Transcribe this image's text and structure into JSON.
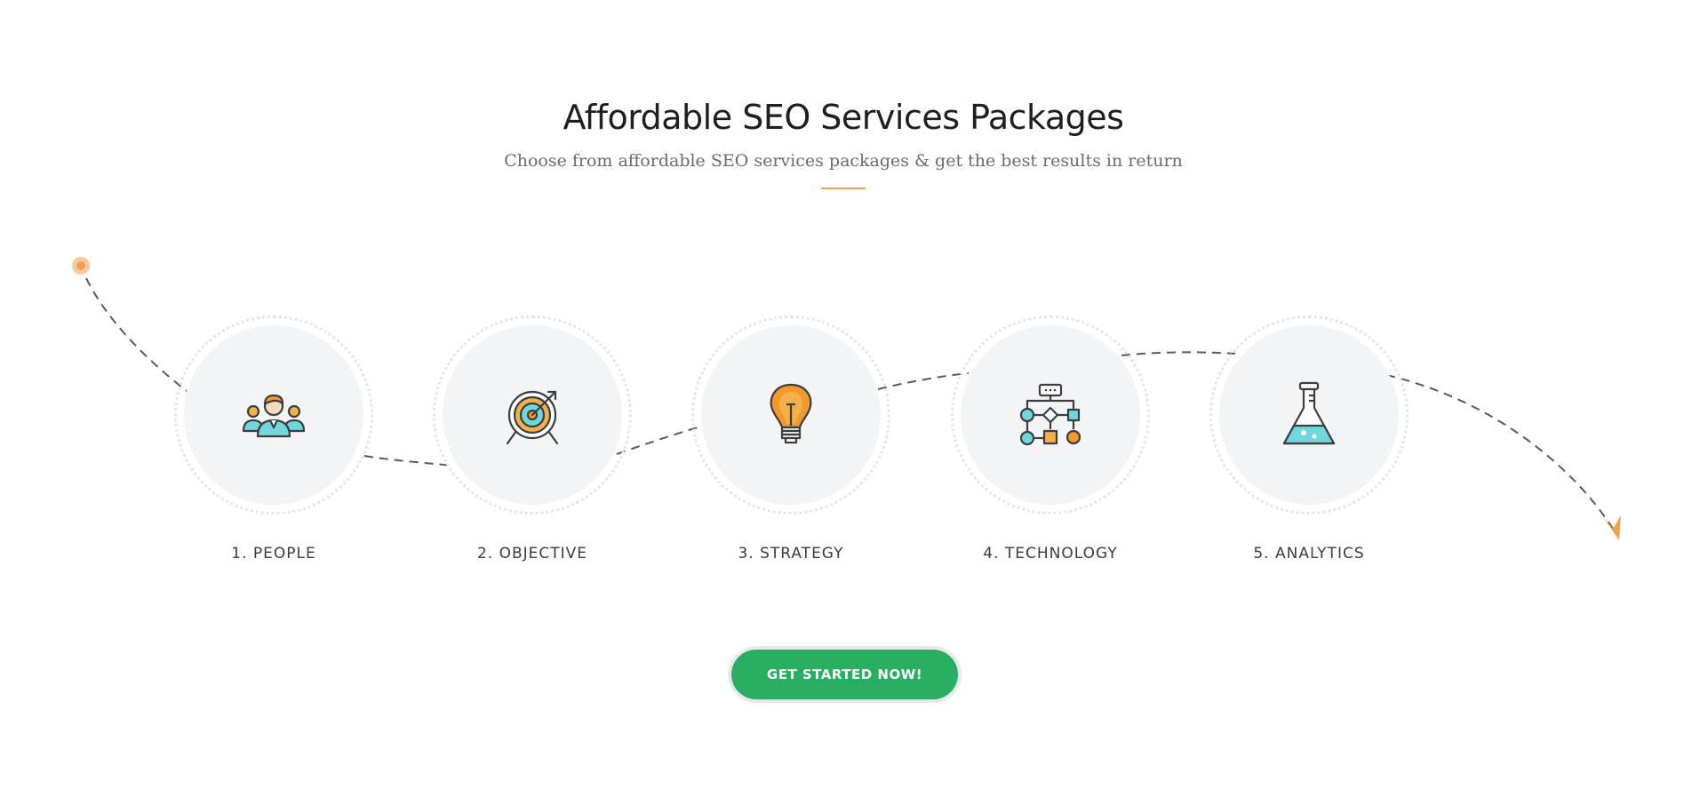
{
  "header": {
    "title": "Affordable SEO Services Packages",
    "subtitle": "Choose from affordable SEO services packages & get the best results in return"
  },
  "colors": {
    "accent": "#f0a050",
    "cta": "#27ae60",
    "circle_bg": "#f3f4f6",
    "teal": "#6fd8dc",
    "orange": "#f2992e"
  },
  "steps": [
    {
      "label": "1. PEOPLE",
      "icon": "people-icon"
    },
    {
      "label": "2. OBJECTIVE",
      "icon": "target-icon"
    },
    {
      "label": "3. STRATEGY",
      "icon": "lightbulb-icon"
    },
    {
      "label": "4. TECHNOLOGY",
      "icon": "flowchart-icon"
    },
    {
      "label": "5. ANALYTICS",
      "icon": "flask-icon"
    }
  ],
  "cta": {
    "label": "GET STARTED NOW!"
  }
}
